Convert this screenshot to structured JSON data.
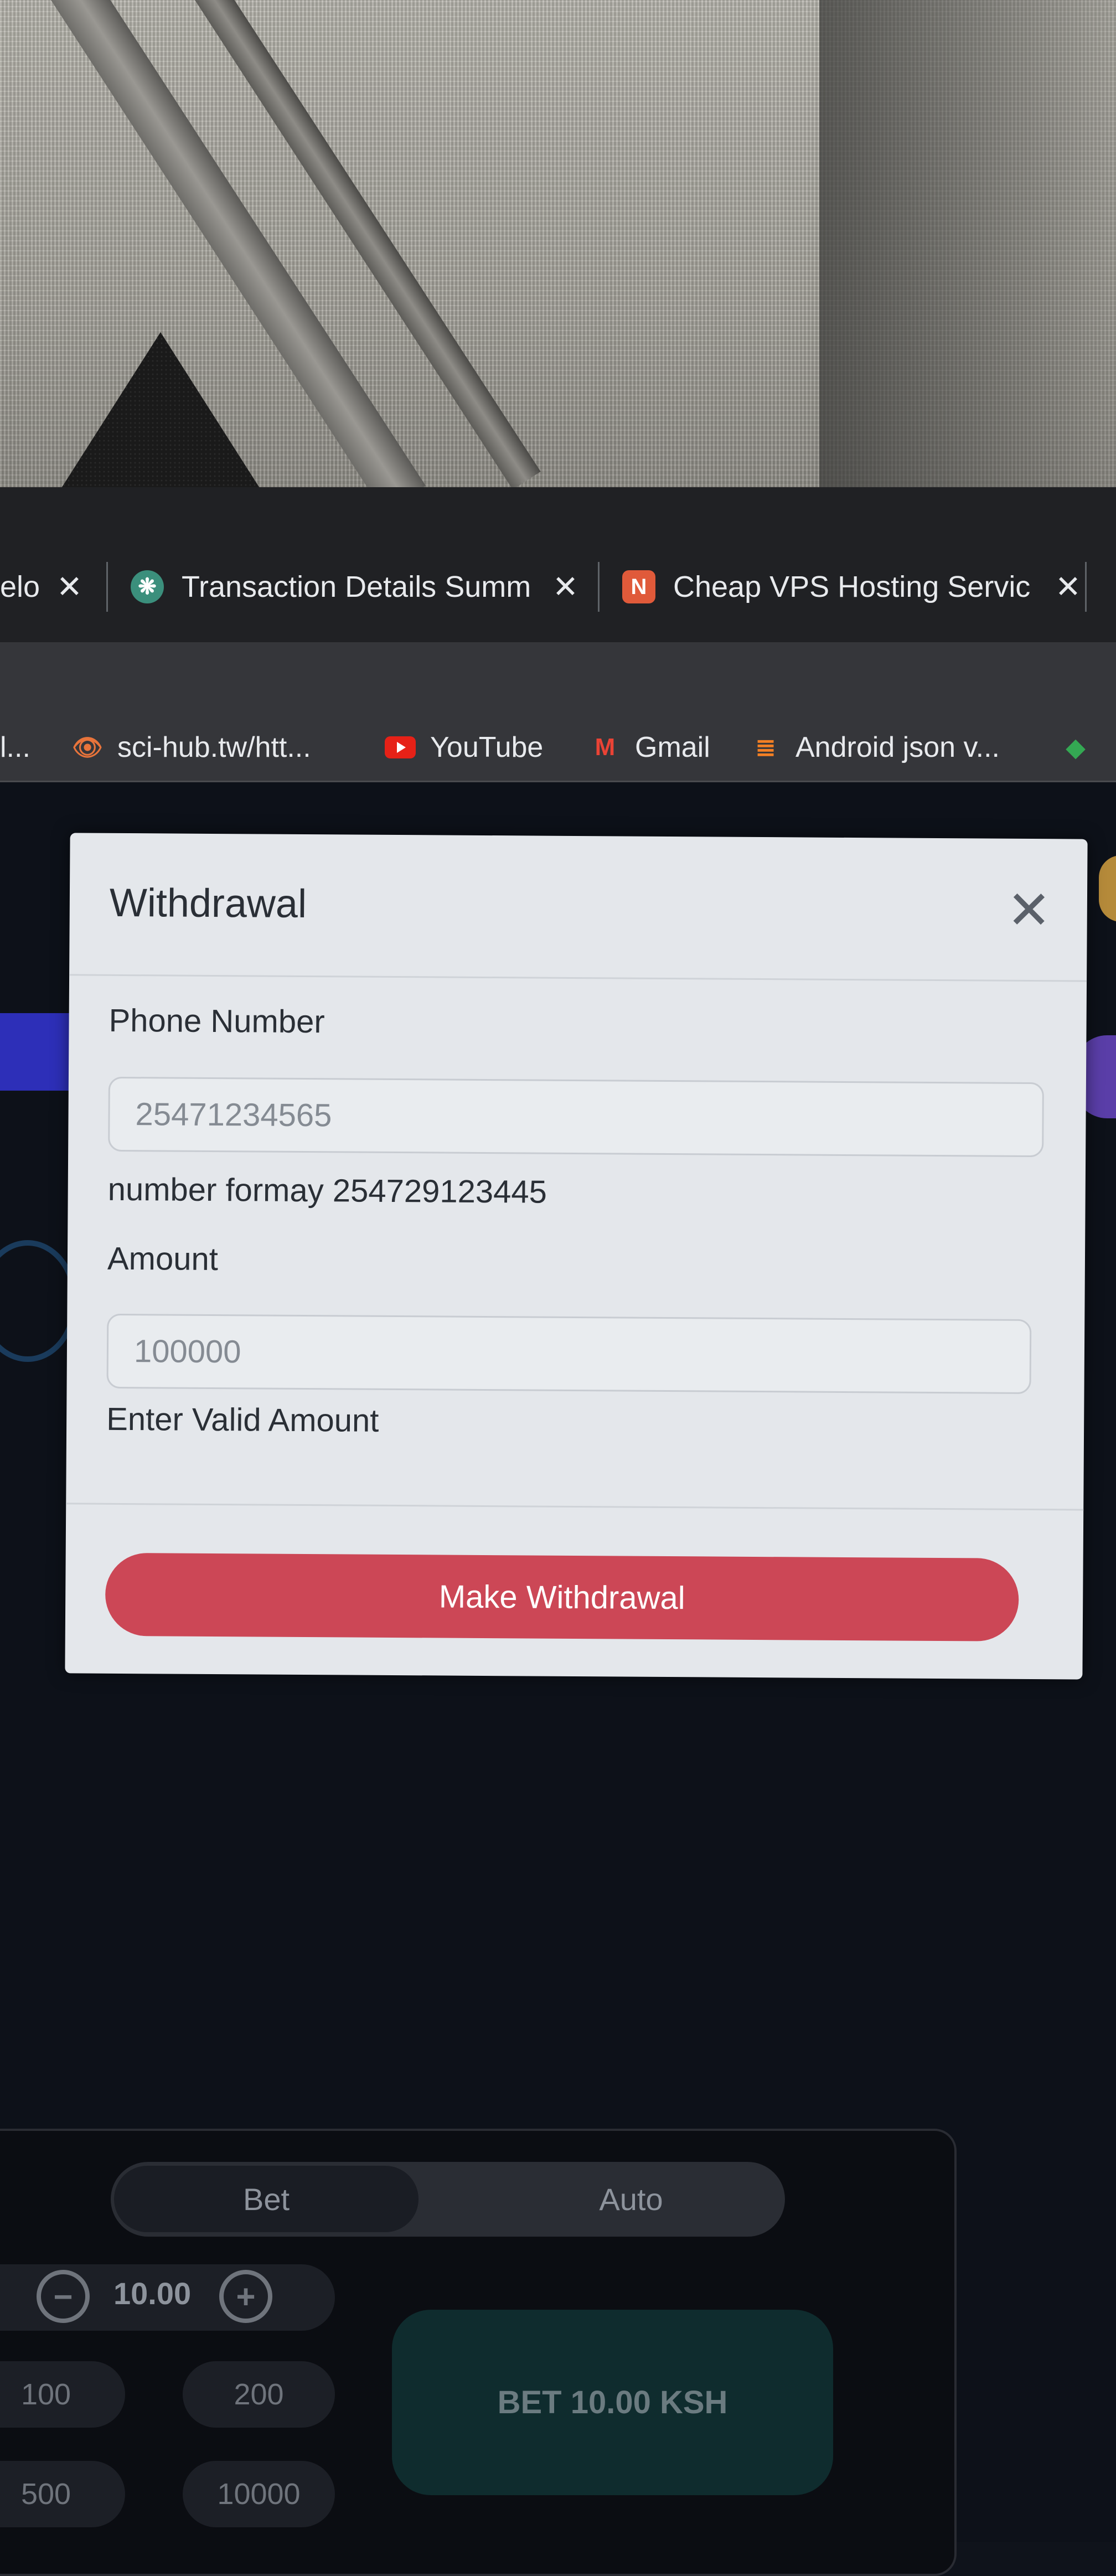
{
  "browser": {
    "tabs": [
      {
        "title": "elo",
        "favicon": ""
      },
      {
        "title": "Transaction Details Summ",
        "favicon": "chatgpt-icon"
      },
      {
        "title": "Cheap VPS Hosting Servic",
        "favicon": "N"
      }
    ],
    "close_glyph": "✕",
    "bookmarks": [
      {
        "label": "l...",
        "icon": ""
      },
      {
        "label": "sci-hub.tw/htt...",
        "icon": "sci-hub-icon"
      },
      {
        "label": "YouTube",
        "icon": "youtube-icon"
      },
      {
        "label": "Gmail",
        "icon": "gmail-icon"
      },
      {
        "label": "Android json v...",
        "icon": "stackoverflow-icon"
      }
    ]
  },
  "modal": {
    "title": "Withdrawal",
    "close_glyph": "✕",
    "phone": {
      "label": "Phone Number",
      "placeholder": "25471234565",
      "help": "number formay 254729123445"
    },
    "amount": {
      "label": "Amount",
      "placeholder": "100000",
      "help": "Enter Valid Amount"
    },
    "submit_label": "Make Withdrawal"
  },
  "bet_panel": {
    "tabs": [
      "Bet",
      "Auto"
    ],
    "amount": "10.00",
    "minus": "−",
    "plus": "+",
    "chips": [
      "100",
      "200",
      "500",
      "10000"
    ],
    "bet_button": "BET 10.00 KSH"
  },
  "colors": {
    "primary": "#cc4756",
    "modal_bg": "#e4e7eb",
    "page_bg": "#0d1119"
  }
}
